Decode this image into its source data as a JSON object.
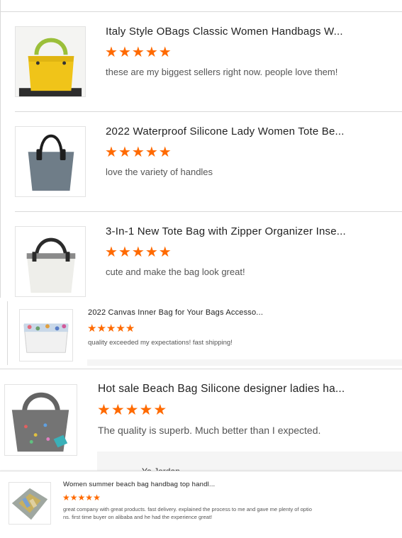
{
  "reviews": [
    {
      "title": "Italy Style OBags Classic Women Handbags W...",
      "rating": 5,
      "comment": "these are my biggest sellers right now. people love them!"
    },
    {
      "title": "2022 Waterproof Silicone Lady Women Tote Be...",
      "rating": 5,
      "comment": "love the variety of handles"
    },
    {
      "title": "3-In-1 New Tote Bag with Zipper Organizer Inse...",
      "rating": 5,
      "comment": "cute and make the bag look great!"
    },
    {
      "title": "2022 Canvas Inner Bag for Your Bags Accesso...",
      "rating": 5,
      "comment": "quality exceeded my expectations! fast shipping!"
    },
    {
      "title": "Hot sale Beach Bag Silicone designer ladies ha...",
      "rating": 5,
      "comment": "The quality is superb. Much better than I expected.",
      "reviewer_partial": "Ya Jordan"
    },
    {
      "title": "Women summer beach bag handbag top handl...",
      "rating": 5,
      "comment_line1": "great company with great products. fast delivery. explained the process to me and gave me plenty of optio",
      "comment_line2": "ns. first time buyer on alibaba and he had the experience great!"
    }
  ],
  "star_glyph": "★",
  "colors": {
    "star": "#ff6a00",
    "divider": "#d9d9d9"
  },
  "product_images": [
    "yellow-tote-bag",
    "grey-tote-bag-black-handles",
    "white-tote-bag-zebra-trim",
    "floral-canvas-inner-bag",
    "grey-beach-bag-with-charms",
    "felt-organizer-insert"
  ]
}
